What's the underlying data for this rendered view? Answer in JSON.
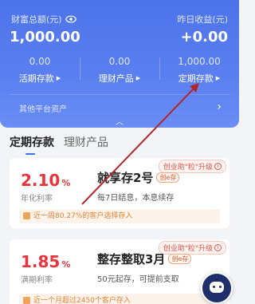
{
  "assets": {
    "total_label": "财富总额(元)",
    "total_value": "1,000.00",
    "yesterday_label": "昨日收益(元)",
    "yesterday_value": "+0.00",
    "sub": [
      {
        "value": "0.00",
        "label": "活期存款"
      },
      {
        "value": "0.00",
        "label": "理财产品"
      },
      {
        "value": "1,000.00",
        "label": "定期存款"
      }
    ],
    "other_assets": "其他平台资产",
    "triangle": "▶",
    "chevron_right": "›",
    "chevron_up": "︿"
  },
  "tabs": [
    {
      "label": "定期存款",
      "active": true
    },
    {
      "label": "理财产品",
      "active": false
    }
  ],
  "products": [
    {
      "rate": "2.10",
      "pct": "%",
      "rate_label": "年化利率",
      "name": "就享存2号",
      "badge": "创e存",
      "desc": "每7日结息，本息续存",
      "promo": "创业助\"粒\"升级",
      "notice": "近一周80.27%的客户选择存入"
    },
    {
      "rate": "1.85",
      "pct": "%",
      "rate_label": "满期利率",
      "name": "整存整取3月",
      "badge": "创e存",
      "desc": "50元起存，可提前支取",
      "promo": "创业助\"粒\"升级",
      "notice": "近一个月超过2450个客户存入"
    }
  ],
  "colors": {
    "accent_blue": "#4d73ea",
    "rate_red": "#e8343a",
    "arrow_red": "#b3262a"
  }
}
